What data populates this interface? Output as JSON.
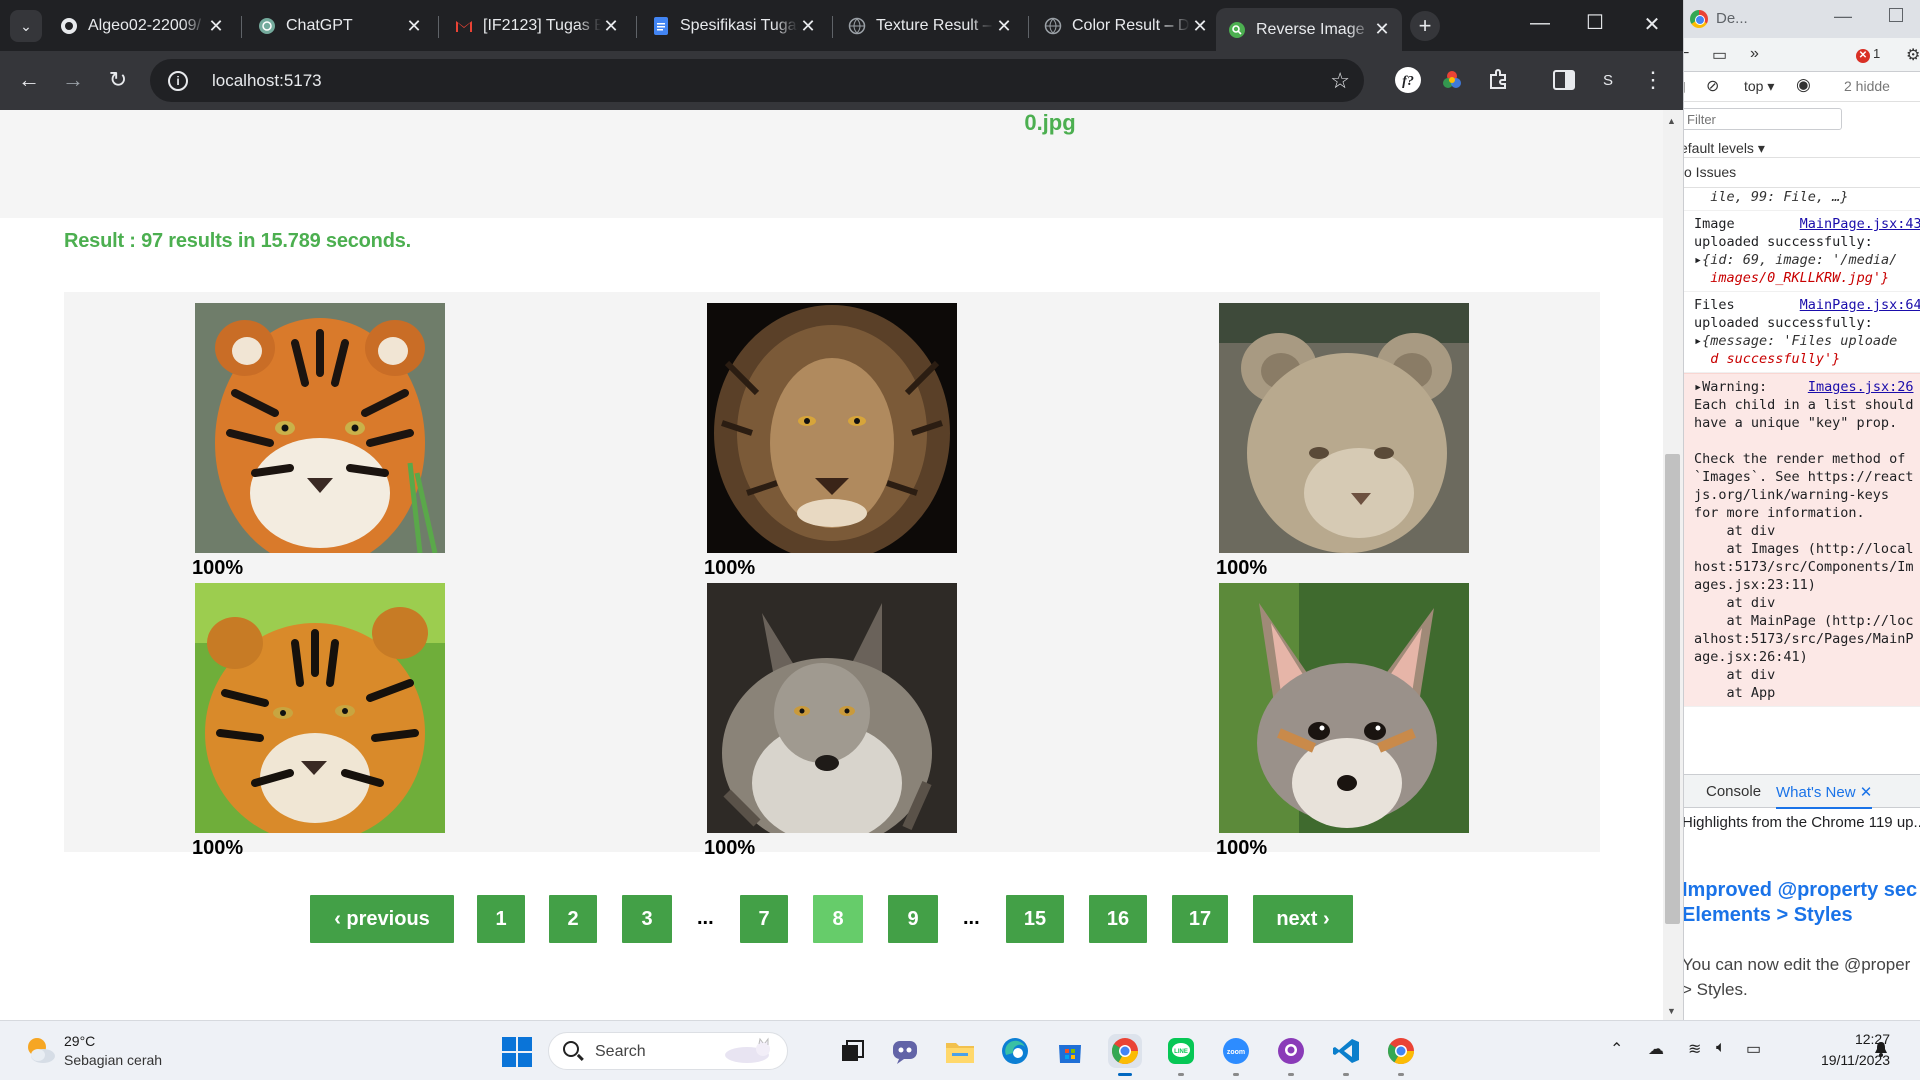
{
  "browser": {
    "tabs": [
      {
        "title": "Algeo02-22009/",
        "icon": "github-icon"
      },
      {
        "title": "ChatGPT",
        "icon": "chatgpt-icon"
      },
      {
        "title": "[IF2123] Tugas B",
        "icon": "gmail-icon"
      },
      {
        "title": "Spesifikasi Tugas",
        "icon": "docs-icon"
      },
      {
        "title": "Texture Result –",
        "icon": "globe-icon"
      },
      {
        "title": "Color Result – D",
        "icon": "globe-icon"
      },
      {
        "title": "Reverse Image",
        "icon": "search-green-icon"
      }
    ],
    "active_tab": 6,
    "url": "localhost:5173",
    "profile_initial": "S"
  },
  "page": {
    "query_filename": "0.jpg",
    "result_text": "Result : 97 results in 15.789 seconds.",
    "results": [
      {
        "animal": "tiger",
        "similarity": "100%"
      },
      {
        "animal": "lion",
        "similarity": "100%"
      },
      {
        "animal": "lion-cub",
        "similarity": "100%"
      },
      {
        "animal": "tiger-on-grass",
        "similarity": "100%"
      },
      {
        "animal": "wolf",
        "similarity": "100%"
      },
      {
        "animal": "fox",
        "similarity": "100%"
      }
    ],
    "pagination": {
      "previous": "‹ previous",
      "next": "next ›",
      "pages": [
        "1",
        "2",
        "3",
        "7",
        "8",
        "9",
        "15",
        "16",
        "17"
      ],
      "ellipsis": "...",
      "current": "8"
    }
  },
  "devtools": {
    "title": "De...",
    "context": "top",
    "hidden": "2 hidde",
    "error_count": "1",
    "filter_placeholder": "Filter",
    "levels": "efault levels",
    "issues": "o Issues",
    "messages": [
      {
        "text": "  ile, 99: File, …}"
      },
      {
        "text": "Image",
        "src": "MainPage.jsx:43"
      },
      {
        "text": "uploaded successfully:"
      },
      {
        "text": "{id: 69, image: '/media/"
      },
      {
        "text": "images/0_RKLLKRW.jpg'}"
      },
      {
        "text": "Files",
        "src": "MainPage.jsx:64"
      },
      {
        "text": "uploaded successfully:"
      },
      {
        "text": "{message: 'Files uploade"
      },
      {
        "text": "d successfully'}"
      }
    ],
    "warning": {
      "label": "Warning:",
      "src": "Images.jsx:26",
      "lines": [
        "Each child in a list should",
        "have a unique \"key\" prop.",
        "",
        "Check the render method of",
        "`Images`. See https://react",
        "js.org/link/warning-keys",
        "for more information.",
        "    at div",
        "    at Images (http://local",
        "host:5173/src/Components/Im",
        "ages.jsx:23:11)",
        "    at div",
        "    at MainPage (http://loc",
        "alhost:5173/src/Pages/MainP",
        "age.jsx:26:41)",
        "    at div",
        "    at App"
      ]
    },
    "drawer_tabs": {
      "console": "Console",
      "whats_new": "What's New"
    },
    "drawer": {
      "highlight": "Highlights from the Chrome 119 up...",
      "heading_1": "Improved @property sec",
      "heading_2": "Elements > Styles",
      "para_1": "You can now edit the @proper",
      "para_2": "> Styles."
    }
  },
  "taskbar": {
    "temperature": "29°C",
    "weather": "Sebagian cerah",
    "search": "Search",
    "time": "12:27",
    "date": "19/11/2023"
  }
}
